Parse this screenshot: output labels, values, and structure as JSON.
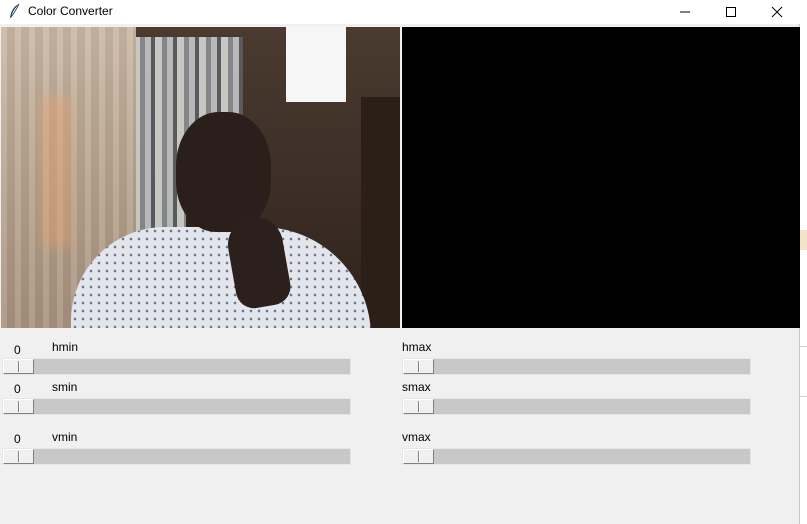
{
  "window": {
    "title": "Color Converter",
    "controls": {
      "minimize": "minimize-icon",
      "maximize": "maximize-icon",
      "close": "close-icon"
    }
  },
  "panels": {
    "left": {
      "content": "webcam-frame"
    },
    "right": {
      "content": "black-mask-frame",
      "color": "#000000"
    }
  },
  "sliders": {
    "hmin": {
      "label": "hmin",
      "value": "0",
      "level": 0
    },
    "smin": {
      "label": "smin",
      "value": "0",
      "level": 0
    },
    "vmin": {
      "label": "vmin",
      "value": "0",
      "level": 0
    },
    "hmax": {
      "label": "hmax",
      "level": 0
    },
    "smax": {
      "label": "smax",
      "level": 0
    },
    "vmax": {
      "label": "vmax",
      "level": 0
    }
  }
}
